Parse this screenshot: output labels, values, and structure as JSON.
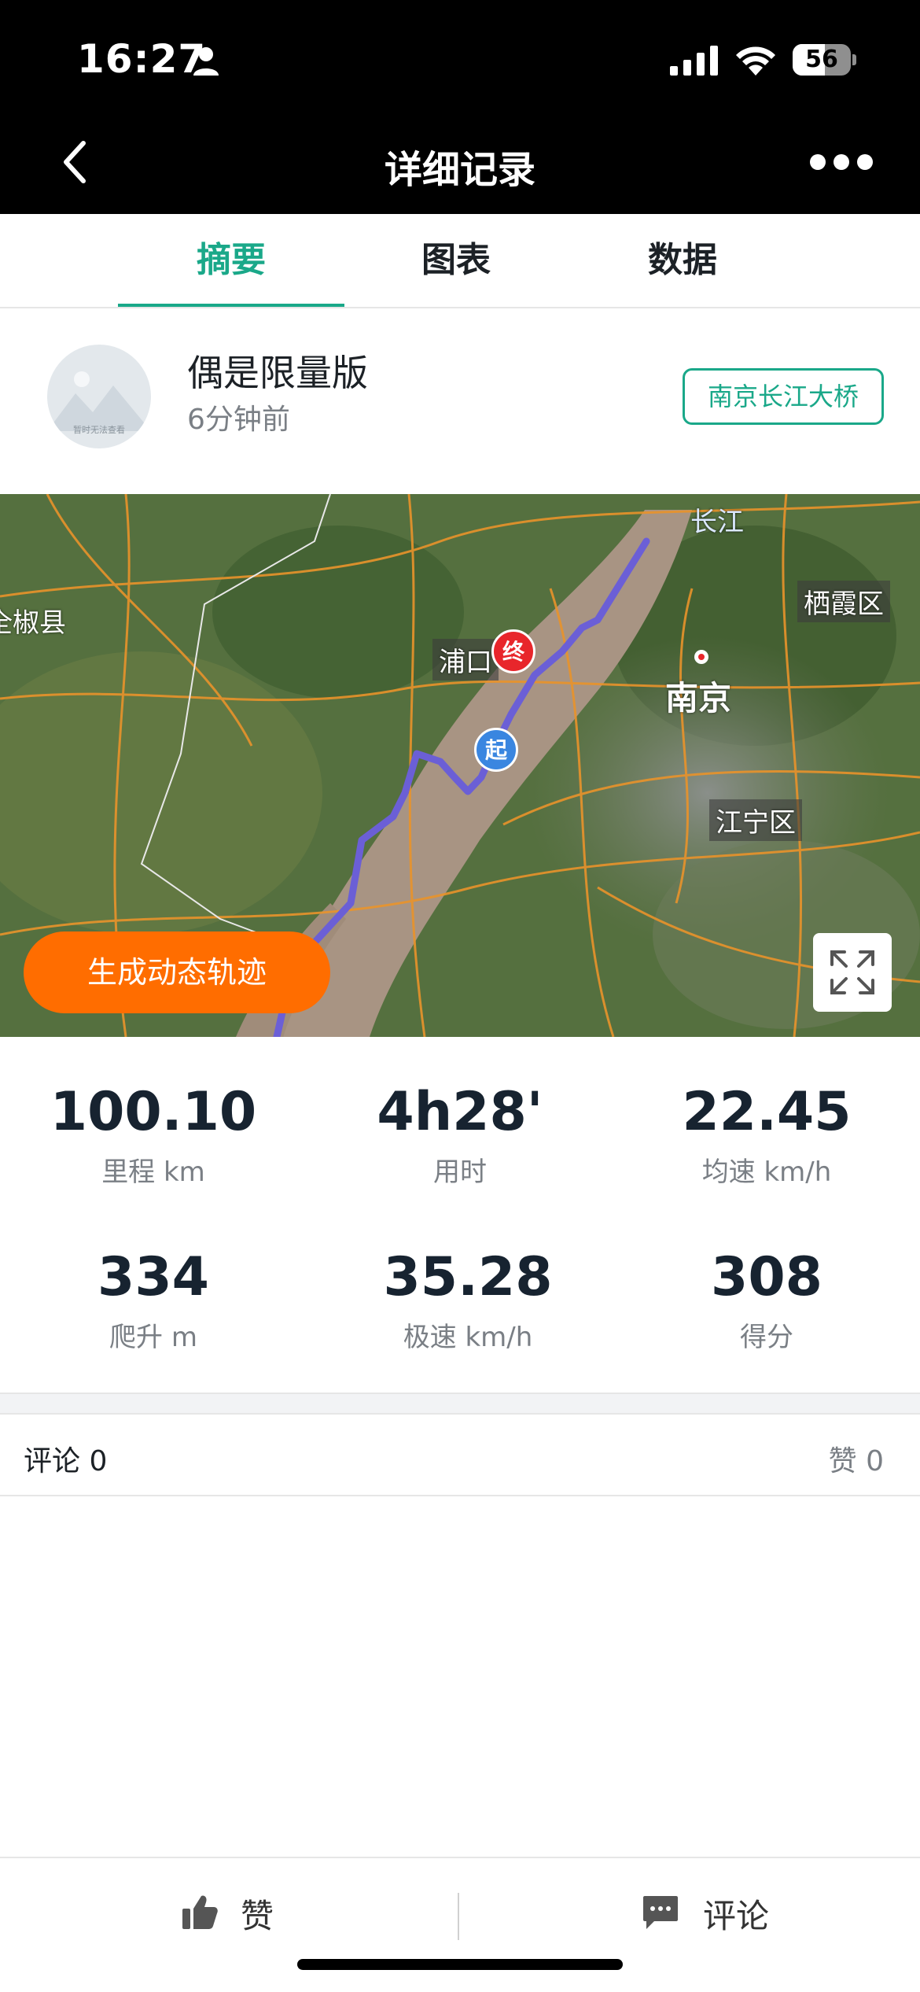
{
  "status_bar": {
    "time": "16:27",
    "battery": "56",
    "battery_level": 0.56
  },
  "header": {
    "title": "详细记录"
  },
  "tabs": [
    {
      "label": "摘要",
      "active": true
    },
    {
      "label": "图表",
      "active": false
    },
    {
      "label": "数据",
      "active": false
    }
  ],
  "profile": {
    "avatar_text": "暂时无法查看",
    "username": "偶是限量版",
    "time_ago": "6分钟前",
    "location_badge": "南京长江大桥"
  },
  "map": {
    "labels": {
      "changjiang": "长江",
      "qixia": "栖霞区",
      "quanjiao": "全椒县",
      "pukou": "浦口",
      "nanjing": "南京",
      "jiangning": "江宁区"
    },
    "end_pin": "终",
    "start_pin": "起",
    "generate_button": "生成动态轨迹",
    "route_color": "#6b5fd6"
  },
  "stats": [
    {
      "value": "100.10",
      "label": "里程 km"
    },
    {
      "value": "4h28'",
      "label": "用时"
    },
    {
      "value": "22.45",
      "label": "均速 km/h"
    },
    {
      "value": "334",
      "label": "爬升 m"
    },
    {
      "value": "35.28",
      "label": "极速 km/h"
    },
    {
      "value": "308",
      "label": "得分"
    }
  ],
  "comments": {
    "comments_label": "评论 0",
    "likes_label": "赞 0"
  },
  "bottom_bar": {
    "like_label": "赞",
    "comment_label": "评论"
  },
  "colors": {
    "accent": "#1aa889",
    "orange": "#ff6d00"
  }
}
